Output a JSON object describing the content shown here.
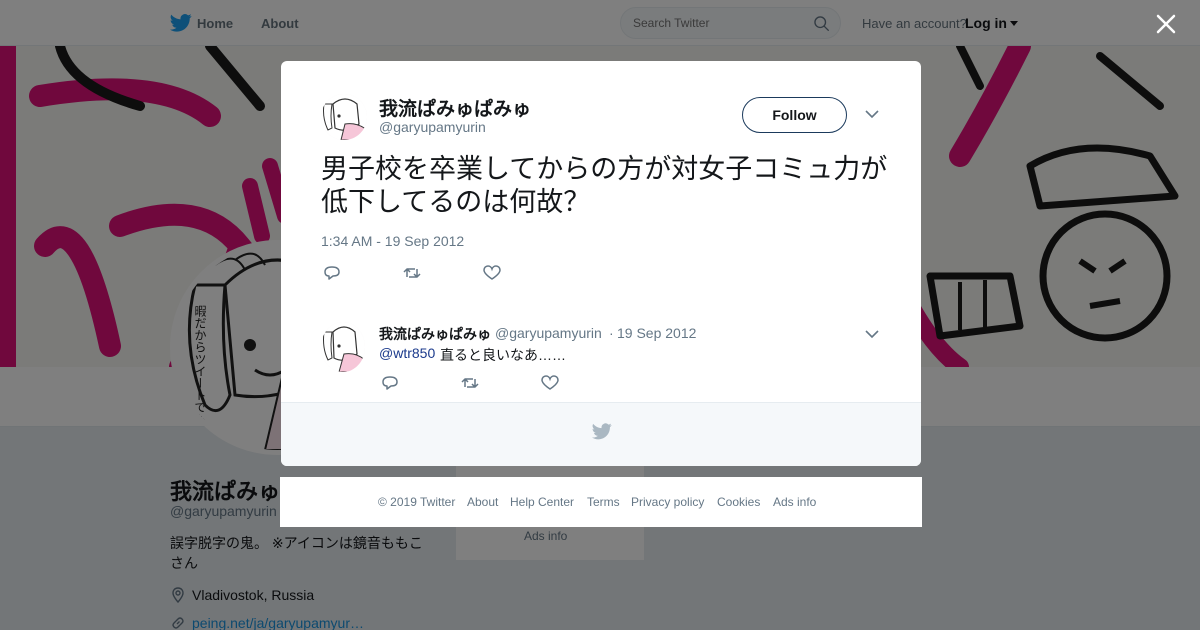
{
  "nav": {
    "home_label": "Home",
    "about_label": "About",
    "search_placeholder": "Search Twitter",
    "have_account": "Have an account?",
    "login_label": "Log in"
  },
  "profile": {
    "name": "我流ぱみゅぱみゅ",
    "handle": "@garyupamyurin",
    "bio": "誤字脱字の鬼。 ※アイコンは鏡音ももこさん",
    "location": "Vladivostok, Russia",
    "url": "peing.net/ja/garyupamyur…",
    "ads_info": "Ads info",
    "avatar_bubble_text": "暇だからツイートでもTLに流すか不穏"
  },
  "tweet": {
    "name": "我流ぱみゅぱみゅ",
    "handle": "@garyupamyurin",
    "follow_label": "Follow",
    "text": "男子校を卒業してからの方が対女子コミュ力が低下してるのは何故？",
    "timestamp": "1:34 AM - 19 Sep 2012"
  },
  "reply": {
    "name": "我流ぱみゅぱみゅ",
    "handle": "@garyupamyurin",
    "separator": "·",
    "date": "19 Sep 2012",
    "mention": "@wtr850",
    "body": "直ると良いなあ……"
  },
  "footer": {
    "items": [
      "© 2019 Twitter",
      "About",
      "Help Center",
      "Terms",
      "Privacy policy",
      "Cookies",
      "Ads info"
    ]
  },
  "colors": {
    "brand_blue": "#1da1f2",
    "banner_pink": "#e0117a",
    "text_primary": "#14171a",
    "text_secondary": "#657786"
  },
  "icons": {
    "logo": "twitter-bird-icon",
    "search": "search-icon",
    "close": "close-icon",
    "reply": "reply-icon",
    "retweet": "retweet-icon",
    "like": "heart-icon",
    "more": "chevron-down-icon",
    "location": "location-pin-icon",
    "link": "link-icon"
  }
}
